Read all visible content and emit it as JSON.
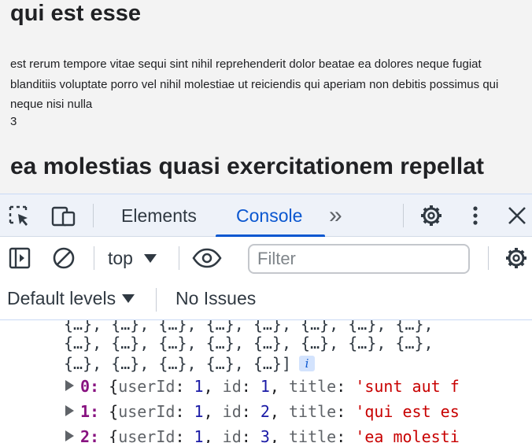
{
  "page": {
    "post1_title": "qui est esse",
    "post1_body": "est rerum tempore vitae sequi sint nihil reprehenderit dolor beatae ea dolores neque fugiat blanditiis voluptate porro vel nihil molestiae ut reiciendis qui aperiam non debitis possimus qui neque nisi nulla",
    "post1_user": "3",
    "post2_title": "ea molestias quasi exercitationem repellat"
  },
  "devtools": {
    "tabs": [
      "Elements",
      "Console"
    ],
    "more_tabs": "»",
    "active_tab": "Console",
    "context": "top",
    "filter_placeholder": "Filter",
    "levels_label": "Default levels",
    "issues_label": "No Issues",
    "icons": {
      "inspect": "select-element-icon",
      "device": "device-toggle-icon",
      "settings": "gear-icon",
      "menu": "kebab-menu-icon",
      "close": "close-icon",
      "sidebar": "sidebar-toggle-icon",
      "clear": "clear-console-icon",
      "eye": "live-expression-icon"
    }
  },
  "console": {
    "array_lines": [
      "{…}, {…}, {…}, {…}, {…}, {…}, {…}, {…},",
      "{…}, {…}, {…}, {…}, {…}, {…}, {…}, {…},",
      "{…}, {…}, {…}, {…}, {…}]"
    ],
    "info_badge": "i",
    "rows": [
      {
        "index": "0",
        "userId": "1",
        "id": "1",
        "title": "'sunt aut f"
      },
      {
        "index": "1",
        "userId": "1",
        "id": "2",
        "title": "'qui est es"
      },
      {
        "index": "2",
        "userId": "1",
        "id": "3",
        "title": "'ea molesti"
      }
    ],
    "key_labels": {
      "userId": "userId",
      "id": "id",
      "title": "title"
    }
  },
  "colors": {
    "accent": "#0b57d0",
    "index": "#881280",
    "number": "#1a1aa6",
    "string": "#c80000"
  }
}
